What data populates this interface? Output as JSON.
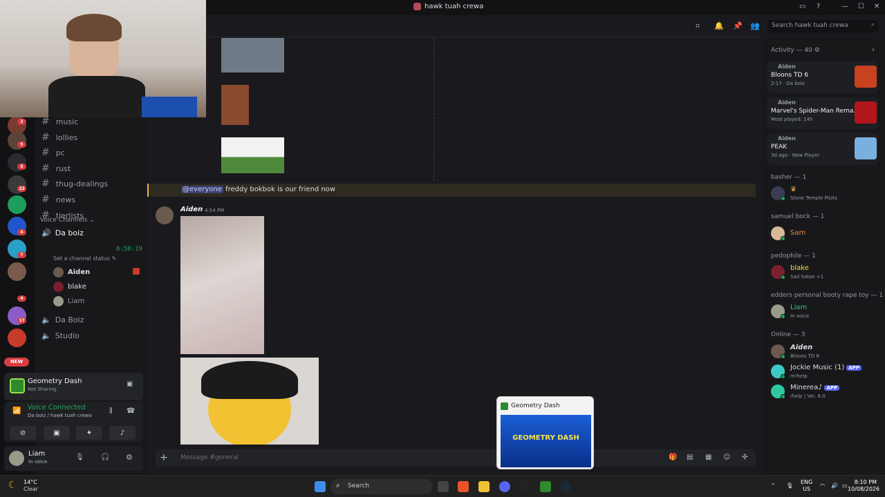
{
  "window": {
    "title": "hawk tuah crewa"
  },
  "servers": {
    "badges": [
      "2",
      "5",
      "5",
      "22",
      "4",
      "7",
      "4",
      "17"
    ],
    "new_label": "NEW"
  },
  "channels": {
    "items": [
      "music",
      "lollies",
      "pc",
      "rust",
      "thug-dealings",
      "news",
      "tierlists"
    ],
    "voice_header": "Voice Channels",
    "voice_main": {
      "name": "Da boiz",
      "timer": "6:58:19",
      "status": "Set a channel status"
    },
    "voice_users": [
      "Aiden",
      "blake",
      "Liam"
    ],
    "other_voice": [
      "Da Boiz",
      "Studio"
    ]
  },
  "activity_panel": {
    "game": "Geometry Dash",
    "sub": "Not Sharing"
  },
  "voice_panel": {
    "title": "Voice Connected",
    "sub": "Da boiz / hawk tuah crewa"
  },
  "user_panel": {
    "name": "Liam",
    "status": "In voice"
  },
  "topbar": {
    "search_placeholder": "Search hawk tuah crewa"
  },
  "chat": {
    "mention": "@everyone",
    "mention_text": "freddy bokbok is our friend now",
    "author": "Aiden",
    "time": "4:54 PM",
    "composer_placeholder": "Message #general"
  },
  "members": {
    "activity_header": "Activity — 40",
    "activities": [
      {
        "name": "Aiden",
        "game": "Bloons TD 6",
        "sub": "2:17 · Da boiz",
        "color": "#c9421f"
      },
      {
        "name": "Aiden",
        "game": "Marvel's Spider-Man Rema...",
        "sub": "Most played: 14h",
        "color": "#b1161c"
      },
      {
        "name": "Aiden",
        "game": "PEAK",
        "sub": "3d ago · New Player",
        "color": "#7ab0e0"
      }
    ],
    "groups": [
      {
        "header": "basher — 1",
        "name": "",
        "status": "Stone Temple Pilots",
        "color": "#dbdee1"
      },
      {
        "header": "samuel bock — 1",
        "name": "Sam",
        "status": "",
        "color": "#e08a3c"
      },
      {
        "header": "pedophile — 1",
        "name": "blake",
        "status": "Sad Satan +1",
        "color": "#f0e040"
      },
      {
        "header": "edders personal booty rape toy — 1",
        "name": "Liam",
        "status": "In voice",
        "color": "#2ecc71"
      }
    ],
    "online_header": "Online — 3",
    "online": [
      {
        "name": "Aiden",
        "status": "Bloons TD 6",
        "app": ""
      },
      {
        "name": "Jockie Music (1)",
        "status": "m!help",
        "app": "APP"
      },
      {
        "name": "Minerea♪",
        "status": "/help | Ver. 8.0",
        "app": "APP"
      }
    ]
  },
  "taskbar_popup": {
    "title": "Geometry Dash",
    "preview_logo": "GEOMETRY DASH"
  },
  "taskbar": {
    "weather_temp": "14°C",
    "weather_desc": "Clear",
    "search": "Search",
    "lang1": "ENG",
    "lang2": "US",
    "time": "8:10 PM",
    "date": "10/08/2026"
  }
}
